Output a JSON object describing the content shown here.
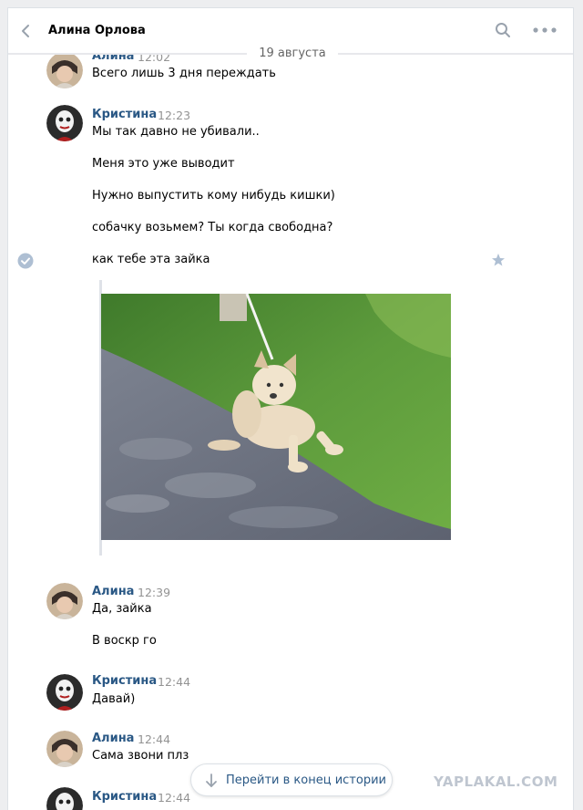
{
  "header": {
    "title": "Алина Орлова",
    "back_icon": "chevron-left-icon",
    "search_icon": "search-icon",
    "more_icon": "more-dots-icon"
  },
  "date_separator": "19 августа",
  "messages": [
    {
      "author": "Алина",
      "time": "12:02",
      "lines": [
        "Всего лишь 3 дня переждать"
      ]
    },
    {
      "author": "Кристина",
      "time": "12:23",
      "lines": [
        "Мы так давно не убивали..",
        "Меня это уже выводит",
        "Нужно выпустить кому нибудь кишки)",
        "собачку возьмем? Ты когда свободна?",
        "как тебе эта зайка"
      ]
    },
    {
      "author": "Алина",
      "time": "12:39",
      "lines": [
        "Да, зайка",
        "В воскр го"
      ]
    },
    {
      "author": "Кристина",
      "time": "12:44",
      "lines": [
        "Давай)"
      ]
    },
    {
      "author": "Алина",
      "time": "12:44",
      "lines": [
        "Сама звони плз"
      ]
    },
    {
      "author": "Кристина",
      "time": "12:44",
      "lines": []
    }
  ],
  "scroll_button": {
    "label": "Перейти в конец истории"
  },
  "watermark": "YAPLAKAL.COM",
  "colors": {
    "author": "#2a5885",
    "time": "#939393",
    "background": "#edeef0"
  }
}
